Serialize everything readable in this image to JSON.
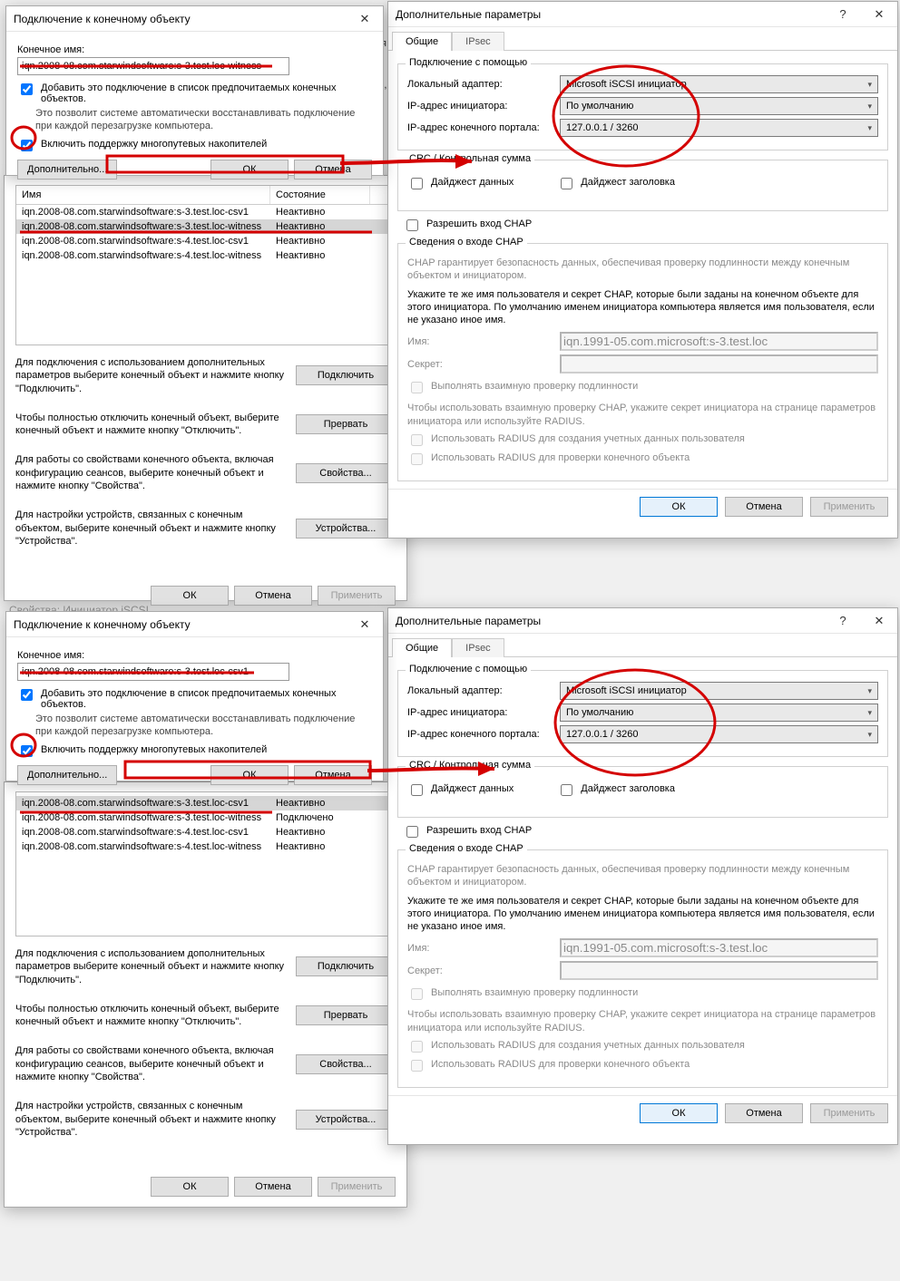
{
  "bg_text": {
    "cfg_tag": "урация",
    "w_tag": "ние,"
  },
  "iscsi_props_title": "Свойства: Инициатор iSCSI",
  "connect1": {
    "title": "Подключение к конечному объекту",
    "endpoint_label": "Конечное имя:",
    "endpoint_value": "iqn.2008-08.com.starwindsoftware:s-3.test.loc-witness",
    "add_fav": "Добавить это подключение в список предпочитаемых конечных объектов.",
    "hint": "Это позволит системе автоматически восстанавливать подключение при каждой перезагрузке компьютера.",
    "mpio": "Включить поддержку многопутевых накопителей",
    "advanced": "Дополнительно...",
    "ok": "ОК",
    "cancel": "Отмена"
  },
  "connect2": {
    "title": "Подключение к конечному объекту",
    "endpoint_label": "Конечное имя:",
    "endpoint_value": "iqn.2008-08.com.starwindsoftware:s-3.test.loc-csv1",
    "add_fav": "Добавить это подключение в список предпочитаемых конечных объектов.",
    "hint": "Это позволит системе автоматически восстанавливать подключение при каждой перезагрузке компьютера.",
    "mpio": "Включить поддержку многопутевых накопителей",
    "advanced": "Дополнительно...",
    "ok": "ОК",
    "cancel": "Отмена"
  },
  "targets": {
    "hdr_name": "Имя",
    "hdr_state": "Состояние",
    "rows1": [
      {
        "n": "iqn.2008-08.com.starwindsoftware:s-3.test.loc-csv1",
        "s": "Неактивно"
      },
      {
        "n": "iqn.2008-08.com.starwindsoftware:s-3.test.loc-witness",
        "s": "Неактивно"
      },
      {
        "n": "iqn.2008-08.com.starwindsoftware:s-4.test.loc-csv1",
        "s": "Неактивно"
      },
      {
        "n": "iqn.2008-08.com.starwindsoftware:s-4.test.loc-witness",
        "s": "Неактивно"
      }
    ],
    "rows2": [
      {
        "n": "iqn.2008-08.com.starwindsoftware:s-3.test.loc-csv1",
        "s": "Неактивно"
      },
      {
        "n": "iqn.2008-08.com.starwindsoftware:s-3.test.loc-witness",
        "s": "Подключено"
      },
      {
        "n": "iqn.2008-08.com.starwindsoftware:s-4.test.loc-csv1",
        "s": "Неактивно"
      },
      {
        "n": "iqn.2008-08.com.starwindsoftware:s-4.test.loc-witness",
        "s": "Неактивно"
      }
    ],
    "p_connect_txt": "Для подключения с использованием дополнительных параметров выберите конечный объект и нажмите кнопку \"Подключить\".",
    "p_disconnect_txt": "Чтобы полностью отключить конечный объект, выберите конечный объект и нажмите кнопку \"Отключить\".",
    "p_props_txt": "Для работы со свойствами конечного объекта, включая конфигурацию сеансов, выберите конечный объект и нажмите кнопку \"Свойства\".",
    "p_devices_txt": "Для настройки устройств, связанных с конечным объектом, выберите конечный объект и нажмите кнопку \"Устройства\".",
    "btn_connect": "Подключить",
    "btn_break": "Прервать",
    "btn_props": "Свойства...",
    "btn_devices": "Устройства...",
    "ok": "ОК",
    "cancel": "Отмена",
    "apply": "Применить"
  },
  "adv": {
    "title": "Дополнительные параметры",
    "tab_general": "Общие",
    "tab_ipsec": "IPsec",
    "grp_conn": "Подключение с помощью",
    "f_adapter": "Локальный адаптер:",
    "v_adapter": "Microsoft iSCSI инициатор",
    "f_initiator": "IP-адрес инициатора:",
    "v_initiator": "По умолчанию",
    "f_portal": "IP-адрес конечного портала:",
    "v_portal": "127.0.0.1 / 3260",
    "grp_crc": "CRC / Контрольная сумма",
    "c_digest_data": "Дайджест данных",
    "c_digest_hdr": "Дайджест заголовка",
    "c_chap_enable": "Разрешить вход CHAP",
    "grp_chap": "Сведения о входе CHAP",
    "chap_hint1": "CHAP гарантирует безопасность данных, обеспечивая проверку подлинности между конечным объектом и инициатором.",
    "chap_hint2": "Укажите те же имя пользователя и секрет CHAP, которые были заданы на конечном объекте для этого инициатора. По умолчанию именем инициатора компьютера является имя пользователя, если не указано иное имя.",
    "f_name": "Имя:",
    "v_name": "iqn.1991-05.com.microsoft:s-3.test.loc",
    "f_secret": "Секрет:",
    "c_mutual": "Выполнять взаимную проверку подлинности",
    "mutual_hint": "Чтобы использовать взаимную проверку CHAP, укажите секрет инициатора на странице параметров инициатора или используйте RADIUS.",
    "c_radius1": "Использовать RADIUS для создания учетных данных пользователя",
    "c_radius2": "Использовать RADIUS для проверки конечного объекта",
    "ok": "ОК",
    "cancel": "Отмена",
    "apply": "Применить"
  }
}
